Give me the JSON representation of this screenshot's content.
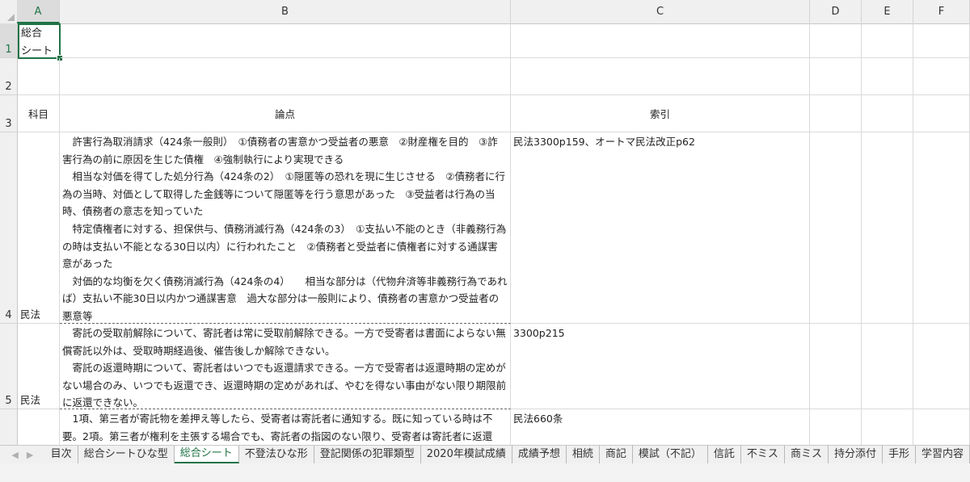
{
  "columns": [
    "A",
    "B",
    "C",
    "D",
    "E",
    "F"
  ],
  "rows": [
    "1",
    "2",
    "3",
    "4",
    "5"
  ],
  "cells": {
    "a1": "総合\nシート",
    "a3": "科目",
    "b3": "論点",
    "c3": "索引",
    "a4": "民法",
    "b4": "　許害行為取消請求（424条一般則）　①債務者の害意かつ受益者の悪意　②財産権を目的　③詐害行為の前に原因を生じた債権　④強制執行により実現できる\n　相当な対価を得てした処分行為（424条の2）　①隠匿等の恐れを現に生じさせる　②債務者に行為の当時、対価として取得した金銭等について隠匿等を行う意思があった　③受益者は行為の当時、債務者の意志を知っていた\n　特定債権者に対する、担保供与、債務消滅行為（424条の3）　①支払い不能のとき（非義務行為の時は支払い不能となる30日以内）に行われたこと　②債務者と受益者に債権者に対する通謀害意があった\n　対価的な均衡を欠く債務消滅行為（424条の4）　　相当な部分は（代物弁済等非義務行為であれば）支払い不能30日以内かつ通謀害意　過大な部分は一般則により、債務者の害意かつ受益者の悪意等",
    "c4": "民法3300p159、オートマ民法改正p62",
    "a5": "民法",
    "b5": "　寄託の受取前解除について、寄託者は常に受取前解除できる。一方で受寄者は書面によらない無償寄託以外は、受取時期経過後、催告後しか解除できない。\n　寄託の返還時期について、寄託者はいつでも返還請求できる。一方で受寄者は返還時期の定めがない場合のみ、いつでも返還でき、返還時期の定めがあれば、やむを得ない事由がない限り期限前に返還できない。",
    "c5": "3300p215",
    "b6": "　1項、第三者が寄託物を差押え等したら、受寄者は寄託者に通知する。既に知っている時は不要。2項。第三者が権利を主張する場合でも、寄託者の指図のない限り、受寄者は寄託者に返還",
    "c6": "民法660条"
  },
  "sheet_tabs": [
    "目次",
    "総合シートひな型",
    "総合シート",
    "不登法ひな形",
    "登記関係の犯罪類型",
    "2020年模試成績",
    "成績予想",
    "相続",
    "商記",
    "模試（不記）",
    "信託",
    "不ミス",
    "商ミス",
    "持分添付",
    "手形",
    "学習内容"
  ],
  "active_tab": "総合シート",
  "colors": {
    "accent": "#217346",
    "header_bg": "#f0f0f0"
  }
}
